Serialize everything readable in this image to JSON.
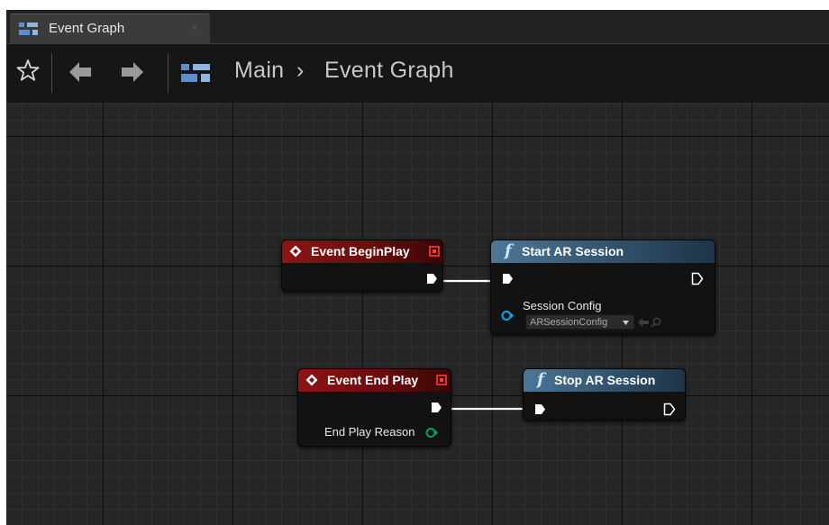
{
  "tab": {
    "label": "Event Graph"
  },
  "breadcrumb": {
    "root": "Main",
    "separator": "›",
    "current": "Event Graph"
  },
  "icons": {
    "tab": "blueprint-graph-icon",
    "favorite": "star-icon",
    "back": "arrow-left-icon",
    "forward": "arrow-right-icon",
    "graph": "blueprint-graph-icon"
  },
  "colors": {
    "event_header": "#8e1414",
    "function_header": "#4d7696",
    "exec_wire": "#ffffff",
    "object_pin": "#00a8f0",
    "enum_pin": "#00a07a"
  },
  "nodes": {
    "begin_play": {
      "title": "Event BeginPlay",
      "type": "event"
    },
    "start_ar_session": {
      "title": "Start AR Session",
      "type": "function",
      "param_label": "Session Config",
      "param_value": "ARSessionConfig"
    },
    "end_play": {
      "title": "Event End Play",
      "type": "event",
      "output_label": "End Play Reason"
    },
    "stop_ar_session": {
      "title": "Stop AR Session",
      "type": "function"
    }
  }
}
